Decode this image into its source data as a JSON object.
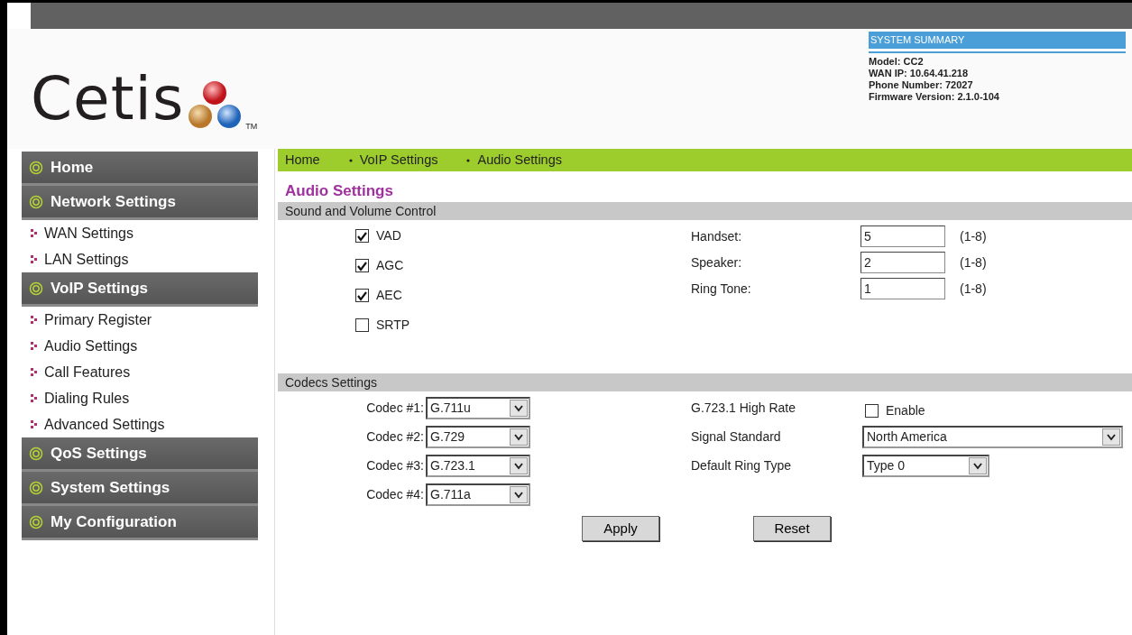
{
  "logo": {
    "text": "Cetis",
    "trademark": "TM"
  },
  "system_summary": {
    "title": "SYSTEM SUMMARY",
    "lines": [
      "Model: CC2",
      "WAN IP: 10.64.41.218",
      "Phone Number: 72027",
      "Firmware Version: 2.1.0-104"
    ]
  },
  "sidebar": {
    "items": [
      {
        "label": "Home"
      },
      {
        "label": "Network Settings",
        "children": [
          {
            "label": "WAN Settings"
          },
          {
            "label": "LAN Settings"
          }
        ]
      },
      {
        "label": "VoIP Settings",
        "children": [
          {
            "label": "Primary Register"
          },
          {
            "label": "Audio Settings"
          },
          {
            "label": "Call Features"
          },
          {
            "label": "Dialing Rules"
          },
          {
            "label": "Advanced Settings"
          }
        ]
      },
      {
        "label": "QoS Settings"
      },
      {
        "label": "System Settings"
      },
      {
        "label": "My Configuration"
      }
    ]
  },
  "breadcrumb": [
    "Home",
    "VoIP Settings",
    "Audio Settings"
  ],
  "page_title": "Audio Settings",
  "sound_section": {
    "title": "Sound and Volume Control",
    "checkboxes": [
      {
        "label": "VAD",
        "checked": true
      },
      {
        "label": "AGC",
        "checked": true
      },
      {
        "label": "AEC",
        "checked": true
      },
      {
        "label": "SRTP",
        "checked": false
      }
    ],
    "volumes": [
      {
        "label": "Handset:",
        "value": "5",
        "range": "(1-8)"
      },
      {
        "label": "Speaker:",
        "value": "2",
        "range": "(1-8)"
      },
      {
        "label": "Ring Tone:",
        "value": "1",
        "range": "(1-8)"
      }
    ]
  },
  "codecs_section": {
    "title": "Codecs Settings",
    "codecs": [
      {
        "label": "Codec #1:",
        "value": "G.711u"
      },
      {
        "label": "Codec #2:",
        "value": "G.729"
      },
      {
        "label": "Codec #3:",
        "value": "G.723.1"
      },
      {
        "label": "Codec #4:",
        "value": "G.711a"
      }
    ],
    "options": [
      {
        "kind": "checkbox",
        "label": "G.723.1 High Rate",
        "text": "Enable",
        "checked": false
      },
      {
        "kind": "select",
        "label": "Signal Standard",
        "value": "North America",
        "wide": true
      },
      {
        "kind": "select",
        "label": "Default Ring Type",
        "value": "Type 0",
        "wide": false
      }
    ]
  },
  "buttons": [
    "Apply",
    "Reset"
  ]
}
